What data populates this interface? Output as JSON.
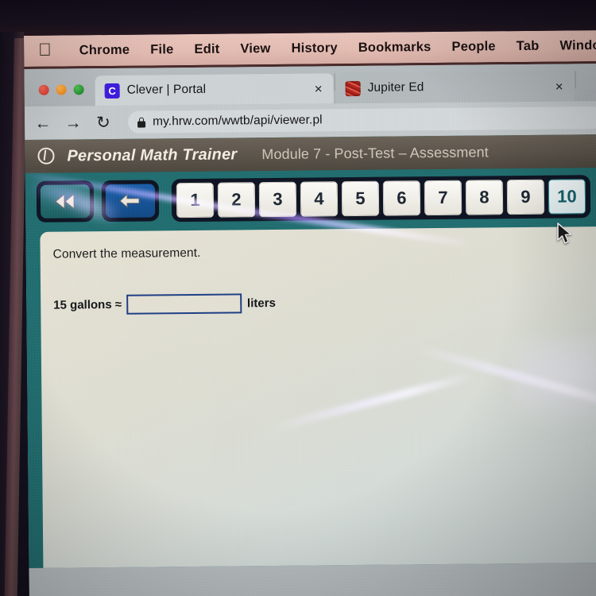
{
  "os_menubar": {
    "apple_icon": "apple-logo-icon",
    "items": [
      "Chrome",
      "File",
      "Edit",
      "View",
      "History",
      "Bookmarks",
      "People",
      "Tab",
      "Window"
    ]
  },
  "browser": {
    "window_controls": [
      "close",
      "minimize",
      "zoom"
    ],
    "tabs": [
      {
        "title": "Clever | Portal",
        "favicon": "clever-c-icon",
        "favicon_letter": "C",
        "active": true,
        "close_label": "×"
      },
      {
        "title": "Jupiter Ed",
        "favicon": "jupiter-planet-icon",
        "favicon_letter": "",
        "active": false,
        "close_label": "×"
      }
    ],
    "toolbar": {
      "back_icon": "←",
      "forward_icon": "→",
      "reload_icon": "↻",
      "lock_icon": "lock-icon",
      "url": "my.hrw.com/wwtb/api/viewer.pl"
    }
  },
  "app": {
    "logo_icon": "personal-math-trainer-logo-icon",
    "title": "Personal Math Trainer",
    "subtitle": "Module 7 - Post-Test – Assessment",
    "nav": {
      "rewind_label": "«",
      "rewind_icon": "double-chevron-left-icon",
      "back_label": "←",
      "back_icon": "arrow-left-icon"
    },
    "question_numbers": [
      "1",
      "2",
      "3",
      "4",
      "5",
      "6",
      "7",
      "8",
      "9",
      "10"
    ],
    "current_question": "10",
    "content": {
      "prompt": "Convert the measurement.",
      "quantity": "15 gallons ≈",
      "answer_value": "",
      "answer_placeholder": "",
      "unit": "liters"
    }
  },
  "colors": {
    "menubar_bg": "#e3bcb2",
    "app_header_bg": "#5d564d",
    "page_teal": "#226e70",
    "card_bg": "#ddddd2",
    "input_border": "#1f3f86",
    "current_question": "#15606b",
    "tab_active_bg": "#cdd2d4"
  }
}
